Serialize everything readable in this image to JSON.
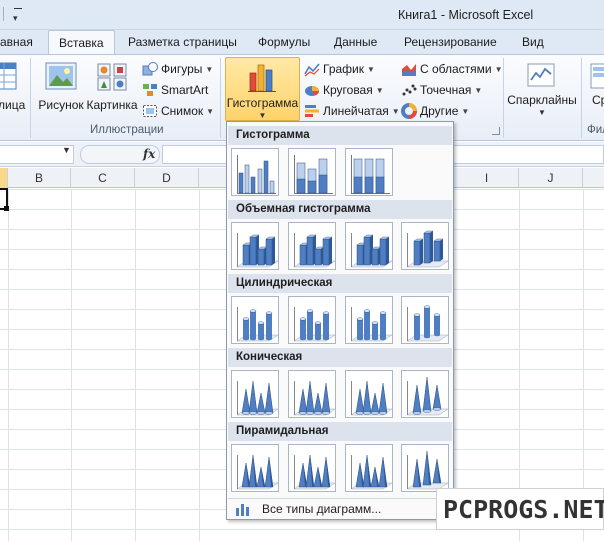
{
  "window": {
    "title": "Книга1 - Microsoft Excel"
  },
  "tabs": {
    "home": "авная",
    "insert": "Вставка",
    "page_layout": "Разметка страницы",
    "formulas": "Формулы",
    "data": "Данные",
    "review": "Рецензирование",
    "view": "Вид"
  },
  "ribbon": {
    "table_label": "лица",
    "picture_label": "Рисунок",
    "clipart_label": "Картинка",
    "shapes_label": "Фигуры",
    "smartart_label": "SmartArt",
    "screenshot_label": "Снимок",
    "illustrations_group": "Иллюстрации",
    "histogram_label": "Гистограмма",
    "line_label": "График",
    "pie_label": "Круговая",
    "bar_label": "Линейчатая",
    "area_label": "С областями",
    "scatter_label": "Точечная",
    "other_label": "Другие",
    "sparklines_label": "Спарклайны",
    "slicer_label": "Ср",
    "filter_group": "Фил"
  },
  "formula_bar": {
    "fx": "fx",
    "value": ""
  },
  "columns": [
    "B",
    "C",
    "D",
    "I",
    "J"
  ],
  "gallery": {
    "categories": [
      {
        "name": "Гистограмма",
        "kind": "column2d"
      },
      {
        "name": "Объемная гистограмма",
        "kind": "column3d"
      },
      {
        "name": "Цилиндрическая",
        "kind": "cylinder"
      },
      {
        "name": "Коническая",
        "kind": "cone"
      },
      {
        "name": "Пирамидальная",
        "kind": "pyramid"
      }
    ],
    "all_types_label": "Все типы диаграмм..."
  },
  "watermark": "PCPROGS.NET",
  "colors": {
    "accent": "#ffd36b",
    "ribbon": "#dfe9f5",
    "chart_blue": "#4f7ec2"
  }
}
